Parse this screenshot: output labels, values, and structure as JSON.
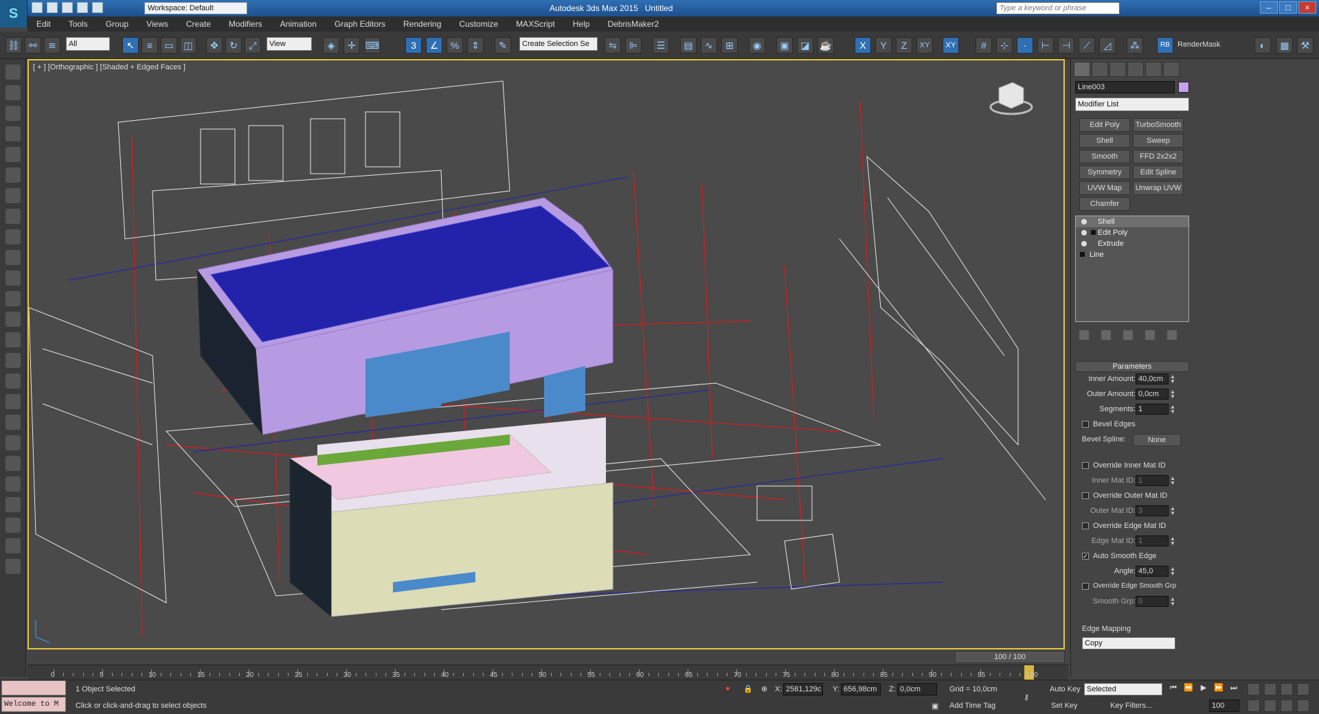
{
  "titlebar": {
    "workspace": "Workspace: Default",
    "title": "Autodesk 3ds Max 2015",
    "file": "Untitled",
    "search_placeholder": "Type a keyword or phrase"
  },
  "menu": [
    "Edit",
    "Tools",
    "Group",
    "Views",
    "Create",
    "Modifiers",
    "Animation",
    "Graph Editors",
    "Rendering",
    "Customize",
    "MAXScript",
    "Help",
    "DebrisMaker2"
  ],
  "toolbar": {
    "selection_filter": "All",
    "ref_coord": "View",
    "named_selection": "Create Selection Se",
    "axis": [
      "X",
      "Y",
      "Z",
      "XY",
      "XY"
    ],
    "rendermask": "RenderMask",
    "rb": "RB"
  },
  "viewport": {
    "label": "[ + ] [Orthographic ] [Shaded + Edged Faces ]",
    "scroll": "100 / 100"
  },
  "command_panel": {
    "object_name": "Line003",
    "object_color": "#c3a0f0",
    "modifier_list": "Modifier List",
    "modifier_buttons": [
      "Edit Poly",
      "TurboSmooth",
      "Shell",
      "Sweep",
      "Smooth",
      "FFD 2x2x2",
      "Symmetry",
      "Edit Spline",
      "UVW Map",
      "Unwrap UVW",
      "Chamfer"
    ],
    "stack": [
      "Shell",
      "Edit Poly",
      "Extrude",
      "Line"
    ],
    "parameters_title": "Parameters",
    "inner_amount_label": "Inner Amount:",
    "inner_amount": "40,0cm",
    "outer_amount_label": "Outer Amount:",
    "outer_amount": "0,0cm",
    "segments_label": "Segments:",
    "segments": "1",
    "bevel_edges": "Bevel Edges",
    "bevel_spline_label": "Bevel Spline:",
    "bevel_spline": "None",
    "override_inner": "Override Inner Mat ID",
    "inner_mat_id_label": "Inner Mat ID:",
    "inner_mat_id": "1",
    "override_outer": "Override Outer Mat ID",
    "outer_mat_id_label": "Outer Mat ID:",
    "outer_mat_id": "3",
    "override_edge": "Override Edge Mat ID",
    "edge_mat_id_label": "Edge Mat ID:",
    "edge_mat_id": "1",
    "auto_smooth": "Auto Smooth Edge",
    "angle_label": "Angle:",
    "angle": "45,0",
    "override_smooth": "Override Edge Smooth Grp",
    "smooth_grp_label": "Smooth Grp:",
    "smooth_grp": "0",
    "edge_mapping_label": "Edge Mapping",
    "edge_mapping": "Copy"
  },
  "timeline": {
    "ticks": [
      "0",
      "5",
      "10",
      "15",
      "20",
      "25",
      "30",
      "35",
      "40",
      "45",
      "50",
      "55",
      "60",
      "65",
      "70",
      "75",
      "80",
      "85",
      "90",
      "95",
      "100"
    ],
    "frame_fraction": 1.0
  },
  "status": {
    "welcome": "Welcome to M",
    "selected": "1 Object Selected",
    "prompt": "Click or click-and-drag to select objects",
    "x_label": "X:",
    "x": "2581,129c",
    "y_label": "Y:",
    "y": "656,98cm",
    "z_label": "Z:",
    "z": "0,0cm",
    "grid": "Grid = 10,0cm",
    "add_time_tag": "Add Time Tag",
    "auto_key": "Auto Key",
    "set_key": "Set Key",
    "key_mode": "Selected",
    "key_filters": "Key Filters...",
    "frame": "100"
  }
}
